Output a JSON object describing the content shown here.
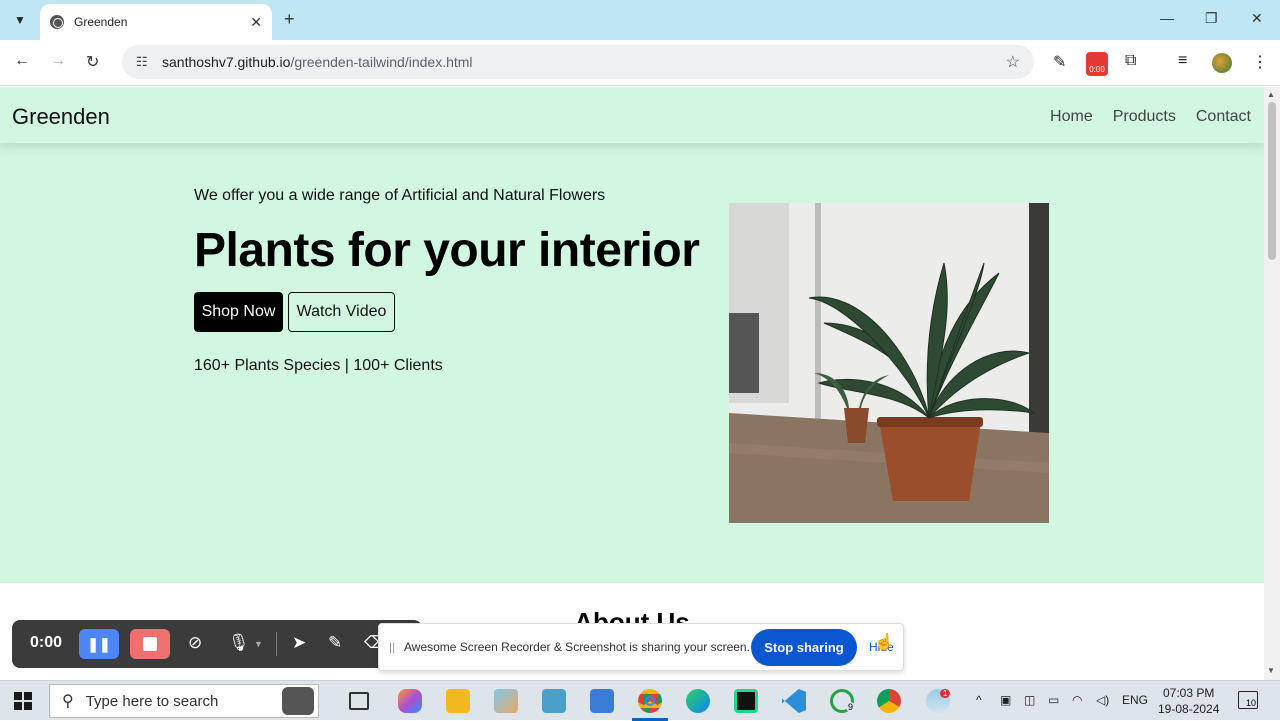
{
  "browser": {
    "tab_title": "Greenden",
    "url_host": "santhoshv7.github.io",
    "url_path": "/greenden-tailwind/index.html",
    "rec_badge": "0:00"
  },
  "site": {
    "brand": "Greenden",
    "nav": [
      "Home",
      "Products",
      "Contact"
    ],
    "hero": {
      "tagline": "We offer you a wide range of Artificial and Natural Flowers",
      "headline": "Plants for your interior",
      "shop_button": "Shop Now",
      "watch_button": "Watch Video",
      "stats": "160+ Plants Species | 100+ Clients"
    },
    "about_title": "About Us"
  },
  "recorder": {
    "time": "0:00"
  },
  "share_bar": {
    "message": "Awesome Screen Recorder & Screenshot is sharing your screen.",
    "stop_button": "Stop sharing",
    "hide_link": "Hide"
  },
  "taskbar": {
    "search_placeholder": "Type here to search",
    "whatsapp_badge": "9",
    "weather_badge": "1",
    "language": "ENG",
    "time": "07:03 PM",
    "date": "19-08-2024",
    "notifications": "10"
  },
  "colors": {
    "hero_bg": "#d1f7e1",
    "tab_strip": "#bfe6f3",
    "share_button": "#0b57d0",
    "pause_button": "#4f86f7",
    "stop_button": "#f07070"
  }
}
